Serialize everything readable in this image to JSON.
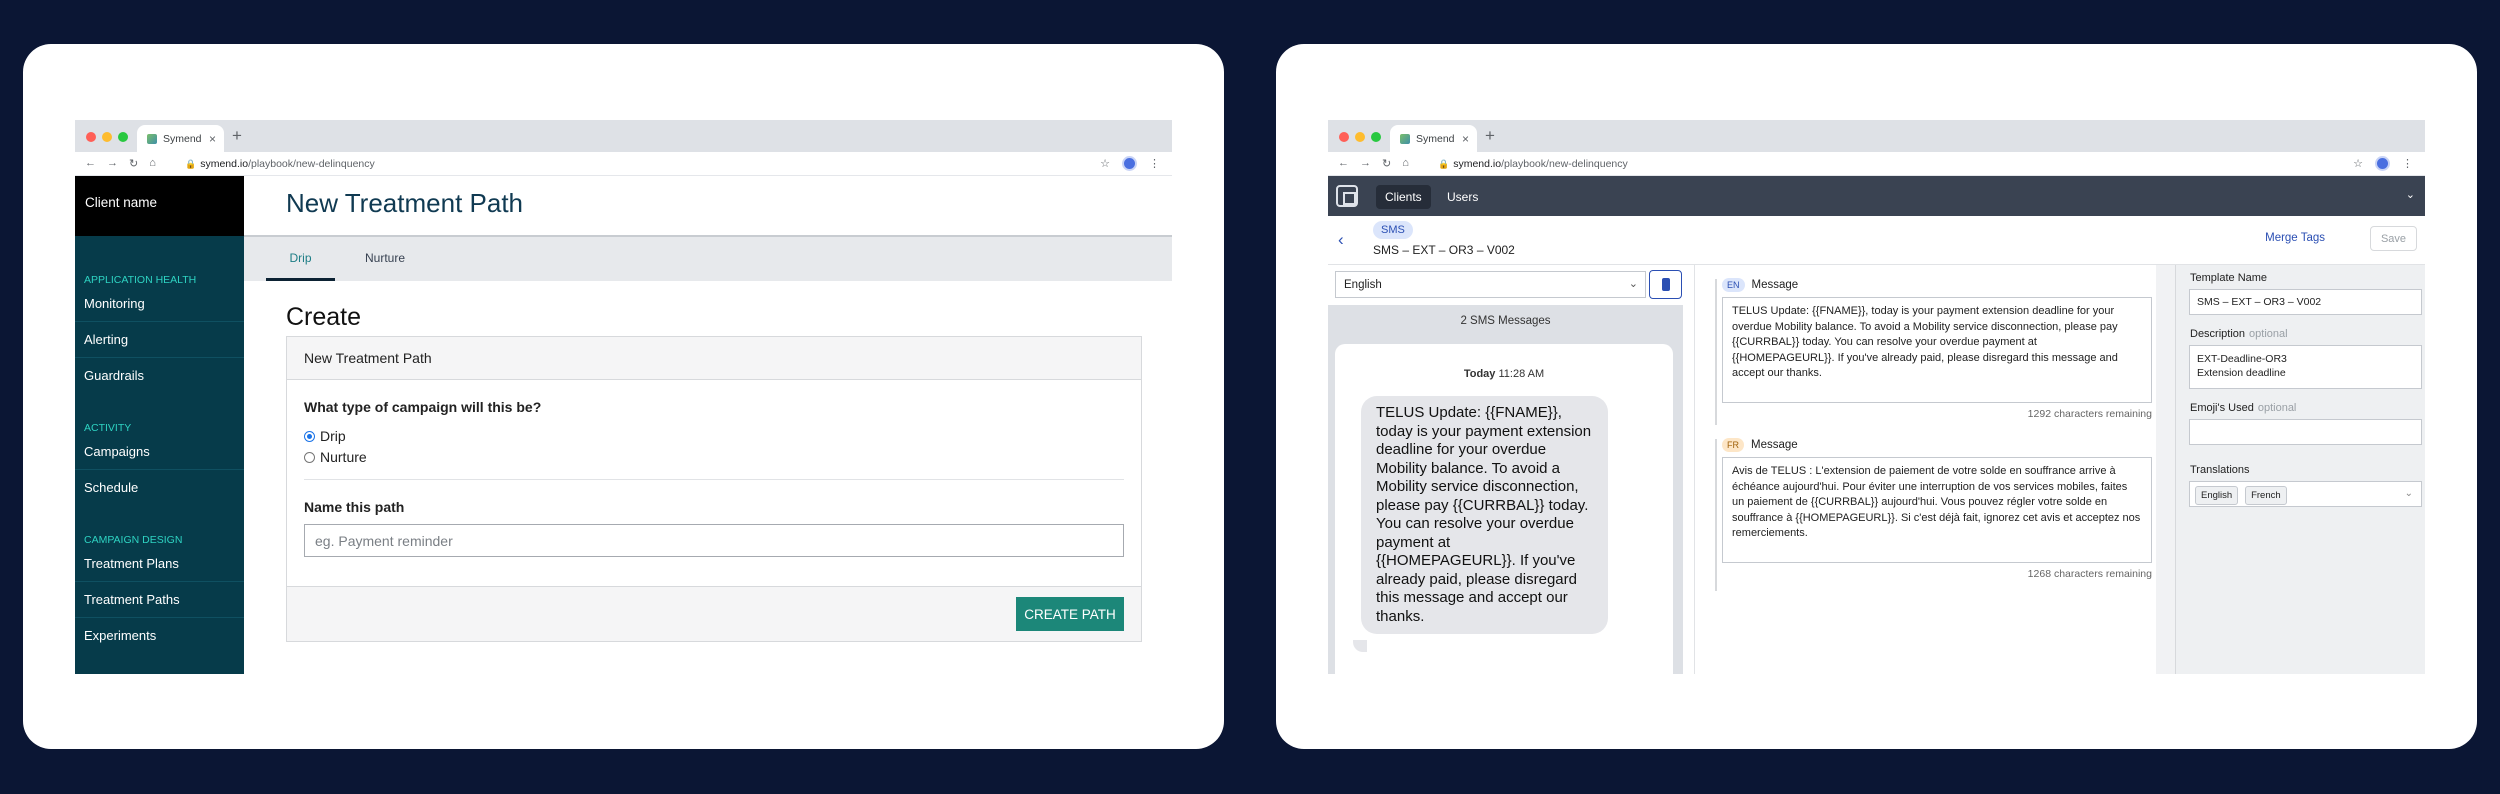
{
  "browser": {
    "tab_title": "Symend",
    "tab_close": "×",
    "new_tab": "+",
    "url_host": "symend.io",
    "url_path": "/playbook/new-delinquency"
  },
  "left": {
    "client_name": "Client name",
    "sections": [
      {
        "title": "APPLICATION HEALTH",
        "items": [
          "Monitoring",
          "Alerting",
          "Guardrails"
        ]
      },
      {
        "title": "ACTIVITY",
        "items": [
          "Campaigns",
          "Schedule"
        ]
      },
      {
        "title": "CAMPAIGN DESIGN",
        "items": [
          "Treatment Plans",
          "Treatment Paths",
          "Experiments"
        ]
      }
    ],
    "page_title": "New Treatment Path",
    "tabs": [
      "Drip",
      "Nurture"
    ],
    "create_heading": "Create",
    "panel_title": "New Treatment Path",
    "question": "What type of campaign will this be?",
    "options": [
      "Drip",
      "Nurture"
    ],
    "name_label": "Name this path",
    "name_placeholder": "eg. Payment reminder",
    "create_button": "CREATE PATH"
  },
  "right": {
    "nav": {
      "clients": "Clients",
      "users": "Users"
    },
    "channel_pill": "SMS",
    "template_title": "SMS – EXT – OR3 – V002",
    "merge_tags": "Merge Tags",
    "save": "Save",
    "language": "English",
    "sms_count": "2 SMS Messages",
    "today": "Today",
    "time": "11:28 AM",
    "bubble_text": "TELUS Update: {{FNAME}}, today is your payment extension deadline for your overdue Mobility balance. To avoid a Mobility service disconnection, please pay {{CURRBAL}} today. You can resolve your overdue payment at {{HOMEPAGEURL}}. If you've already paid, please disregard this message and accept our thanks.",
    "en": {
      "badge": "EN",
      "label": "Message",
      "text": "TELUS Update: {{FNAME}}, today is your payment extension deadline for your overdue Mobility balance. To avoid a Mobility service disconnection, please pay {{CURRBAL}} today. You can resolve your overdue payment at {{HOMEPAGEURL}}. If you've already paid, please disregard this message and accept our thanks.",
      "remaining": "1292 characters remaining"
    },
    "fr": {
      "badge": "FR",
      "label": "Message",
      "text": "Avis de TELUS : L'extension de paiement de votre solde en souffrance arrive à échéance aujourd'hui. Pour éviter une interruption de vos services mobiles, faites un paiement de {{CURRBAL}} aujourd'hui. Vous pouvez régler votre solde en souffrance à {{HOMEPAGEURL}}. Si c'est déjà fait, ignorez cet avis et acceptez nos remerciements.",
      "remaining": "1268 characters remaining"
    },
    "template_name_label": "Template Name",
    "template_name_value": "SMS – EXT – OR3 – V002",
    "description_label": "Description",
    "optional": "optional",
    "description_line1": "EXT-Deadline-OR3",
    "description_line2": "Extension deadline",
    "emojis_label": "Emoji's Used",
    "translations_label": "Translations",
    "translations": [
      "English",
      "French"
    ]
  },
  "colors": {
    "page_bg": "#0b1634",
    "sidebar": "#063b4a",
    "accent_teal": "#1c8779",
    "accent_blue": "#2b4fb3"
  }
}
